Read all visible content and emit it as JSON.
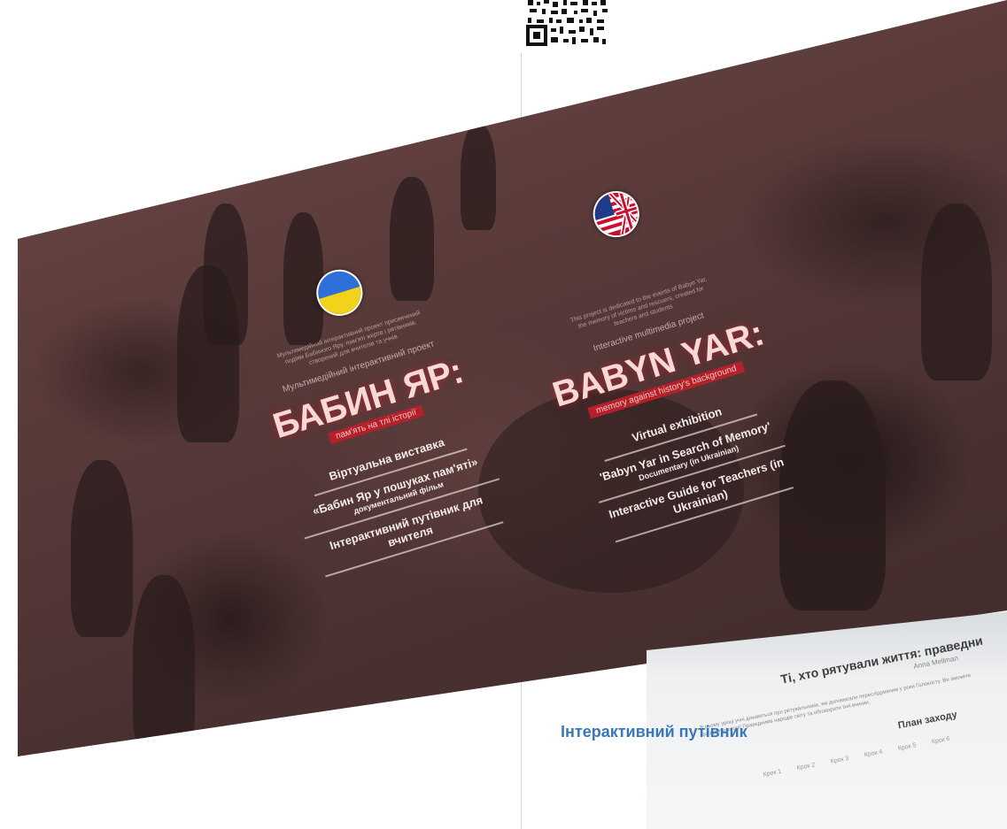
{
  "qr": {
    "icon": "qr-code-icon"
  },
  "ukrainian": {
    "flag_icon": "ukraine-flag-icon",
    "blurb": "Мультимедійний інтерактивний проект присвячений подіям Бабиного Яру, пам'яті жертв і рятівників, створений для вчителів та учнів",
    "project_label": "Мультимедійний інтерактивний проект",
    "title": "БАБИН ЯР:",
    "subtitle": "пам'ять на тлі історії",
    "items": [
      {
        "label": "Віртуальна виставка",
        "sub": ""
      },
      {
        "label": "«Бабин Яр у пошуках пам'яті»",
        "sub": "документальний фільм"
      },
      {
        "label": "Інтерактивний путівник для вчителя",
        "sub": ""
      }
    ]
  },
  "english": {
    "flag_icon": "uk-us-flag-icon",
    "blurb": "This project is dedicated to the events of Babyn Yar, the memory of victims and rescuers, created for teachers and students",
    "project_label": "Interactive multimedia project",
    "title": "BABYN YAR:",
    "subtitle": "memory against history's background",
    "items": [
      {
        "label": "Virtual exhibition",
        "sub": ""
      },
      {
        "label": "'Babyn Yar in Search of Memory'",
        "sub": "Documentary (in Ukrainian)"
      },
      {
        "label": "Interactive Guide for Teachers (in Ukrainian)",
        "sub": ""
      }
    ]
  },
  "preview_card": {
    "title": "Ті, хто рятували життя: праведни",
    "author": "Anna Mellman",
    "text": "В цьому уроці учні дізнаються про рятувальників, які допомагали переслідуваним у роки Голокосту. Ви зможете дослідити історії Праведників народів світу та обговорити їхні вчинки.",
    "plan_title": "План заходу",
    "steps": [
      "Крок 1",
      "Крок 2",
      "Крок 3",
      "Крок 4",
      "Крок 5",
      "Крок 6"
    ]
  },
  "bottom_link": "Інтерактивний путівник",
  "colors": {
    "accent_red": "#b5202a",
    "link_blue": "#3a77b8",
    "photo_tint": "#5a3b3a"
  }
}
